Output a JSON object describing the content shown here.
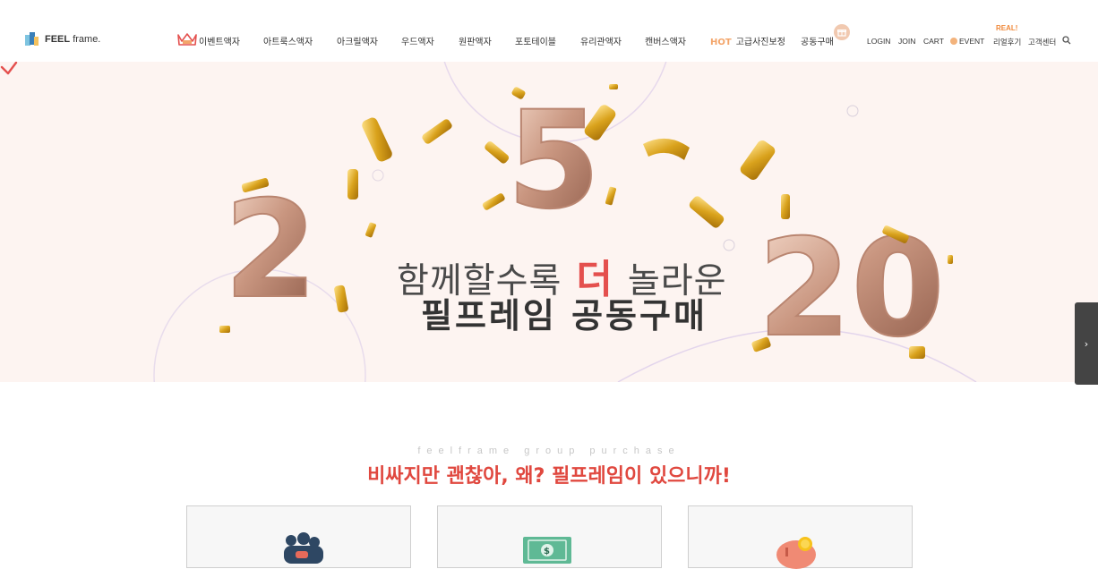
{
  "logo": {
    "brand": "FEEL",
    "suffix": "frame."
  },
  "nav": [
    {
      "label": "이벤트액자"
    },
    {
      "label": "아트룩스액자"
    },
    {
      "label": "아크릴액자"
    },
    {
      "label": "우드액자"
    },
    {
      "label": "원판액자"
    },
    {
      "label": "포토테이블"
    },
    {
      "label": "유리관액자"
    },
    {
      "label": "캔버스액자"
    },
    {
      "label": "고급사진보정",
      "badge": "HOT"
    },
    {
      "label": "공동구매"
    }
  ],
  "utility": {
    "login": "LOGIN",
    "join": "JOIN",
    "cart": "CART",
    "event": "EVENT",
    "reviews": "리얼후기",
    "reviews_badge": "REAL!",
    "support": "고객센터"
  },
  "hero": {
    "digits": [
      "2",
      "5",
      "20"
    ],
    "line1_before": "함께할수록",
    "line1_accent": "더",
    "line1_after": "놀라운",
    "line2": "필프레임 공동구매"
  },
  "section": {
    "eyebrow": "feelframe group purchase",
    "title": "비싸지만 괜찮아, 왜? 필프레임이 있으니까!"
  },
  "cards": [
    {
      "icon": "people-icon"
    },
    {
      "icon": "money-icon"
    },
    {
      "icon": "piggy-bank-icon"
    }
  ],
  "colors": {
    "accent": "#e0483f",
    "hot": "#f3a56a",
    "banner_bg": "#fdf4f1"
  }
}
